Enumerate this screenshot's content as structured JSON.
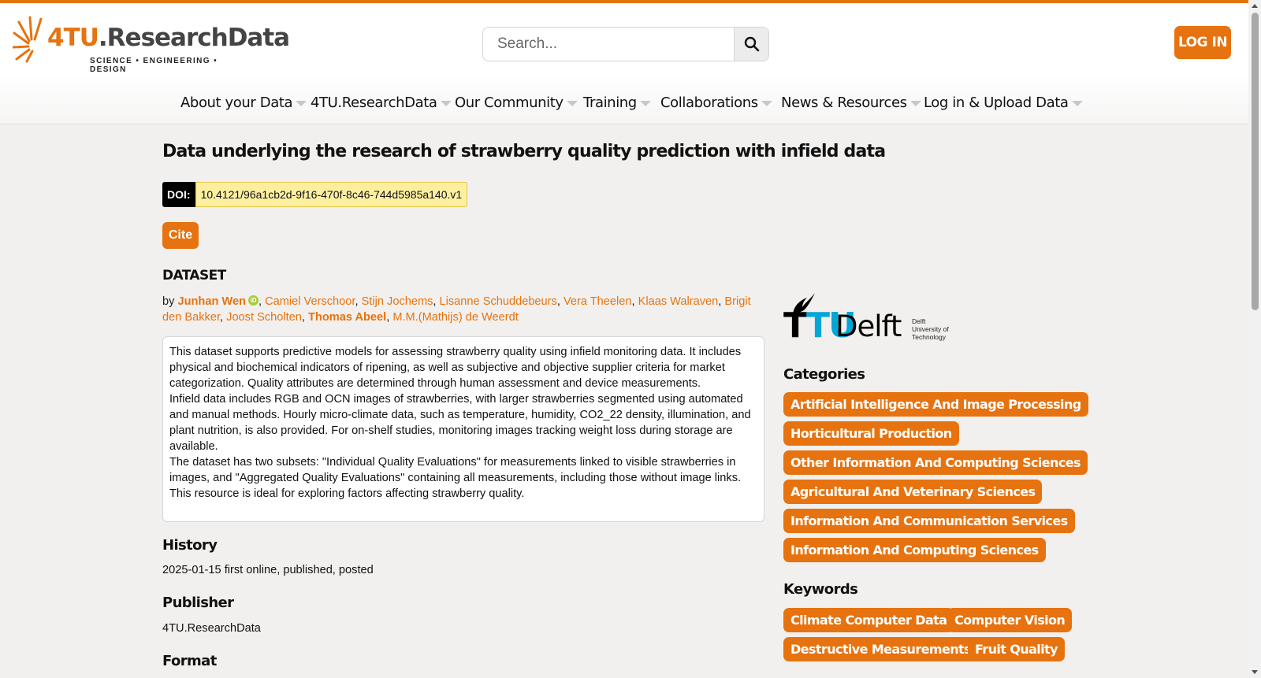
{
  "header": {
    "logo_main": "4TU",
    "logo_suffix": ".ResearchData",
    "logo_tagline": "SCIENCE • ENGINEERING • DESIGN",
    "search_placeholder": "Search...",
    "login_label": "LOG IN",
    "accent_color": "#e6730f"
  },
  "nav": {
    "items": [
      {
        "label": "About your Data"
      },
      {
        "label": "4TU.ResearchData"
      },
      {
        "label": "Our Community"
      },
      {
        "label": "Training"
      },
      {
        "label": "Collaborations"
      },
      {
        "label": "News & Resources"
      },
      {
        "label": "Log in & Upload Data"
      }
    ]
  },
  "dataset": {
    "title": "Data underlying the research of strawberry quality prediction with infield data",
    "doi_label": "DOI:",
    "doi": "10.4121/96a1cb2d-9f16-470f-8c46-744d5985a140.v1",
    "cite_label": "Cite",
    "type": "DATASET",
    "by": "by",
    "authors": [
      "Junhan Wen",
      "Camiel Verschoor",
      "Stijn Jochems",
      "Lisanne Schuddebeurs",
      "Vera Theelen",
      "Klaas Walraven",
      "Brigit den Bakker",
      "Joost Scholten",
      "Thomas Abeel",
      "M.M.(Mathijs) de Weerdt"
    ],
    "description": [
      "This dataset supports predictive models for assessing strawberry quality using infield monitoring data. It includes physical and biochemical indicators of ripening, as well as subjective and objective supplier criteria for market categorization. Quality attributes are determined through human assessment and device measurements.",
      "Infield data includes RGB and OCN images of strawberries, with larger strawberries segmented using automated and manual methods. Hourly micro-climate data, such as temperature, humidity, CO2_22 density, illumination, and plant nutrition, is also provided. For on-shelf studies, monitoring images tracking weight loss during storage are available.",
      "The dataset has two subsets: \"Individual Quality Evaluations\" for measurements linked to visible strawberries in images, and \"Aggregated Quality Evaluations\" containing all measurements, including those without image links. This resource is ideal for exploring factors affecting strawberry quality."
    ],
    "history_heading": "History",
    "history_value": "2025-01-15 first online, published, posted",
    "publisher_heading": "Publisher",
    "publisher_value": "4TU.ResearchData",
    "format_heading": "Format"
  },
  "sidebar": {
    "institution_logo": {
      "tu": "TU",
      "delft": "Delft",
      "s1": "Delft",
      "s2": "University of",
      "s3": "Technology"
    },
    "categories_heading": "Categories",
    "categories": [
      "Artificial Intelligence And Image Processing",
      "Horticultural Production",
      "Other Information And Computing Sciences",
      "Agricultural And Veterinary Sciences",
      "Information And Communication Services",
      "Information And Computing Sciences"
    ],
    "keywords_heading": "Keywords",
    "keywords": [
      "Climate Computer Data",
      "Computer Vision",
      "Destructive Measurements",
      "Fruit Quality"
    ]
  }
}
